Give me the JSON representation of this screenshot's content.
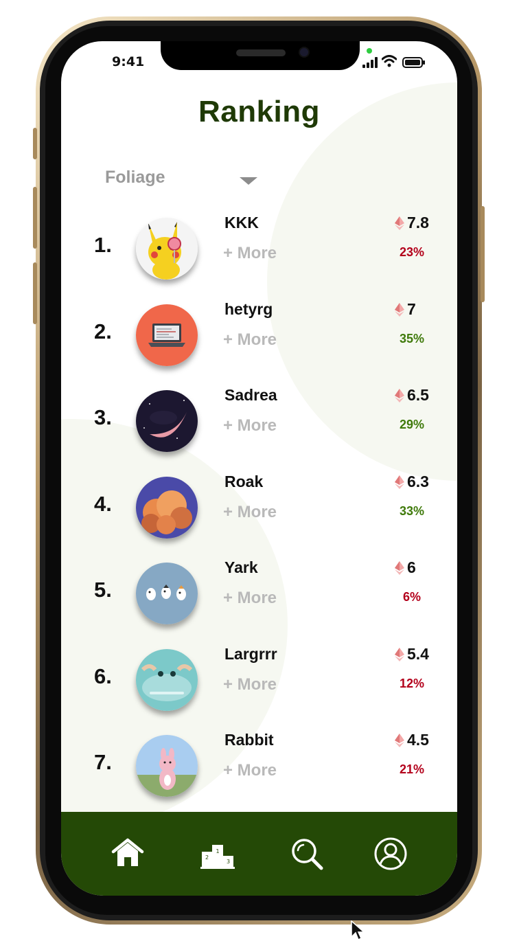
{
  "status": {
    "time": "9:41"
  },
  "header": {
    "title": "Ranking"
  },
  "filter": {
    "selected": "Foliage"
  },
  "colors": {
    "brand_green": "#244906",
    "title_green": "#1f3a06",
    "positive": "#3f7a0b",
    "negative": "#b3001b"
  },
  "rankings": [
    {
      "rank": "1.",
      "name": "KKK",
      "more": "+ More",
      "score": "7.8",
      "change": "23%",
      "trend": "negative",
      "avatar": "pikachu-avatar"
    },
    {
      "rank": "2.",
      "name": "hetyrg",
      "more": "+ More",
      "score": "7",
      "change": "35%",
      "trend": "positive",
      "avatar": "laptop-avatar"
    },
    {
      "rank": "3.",
      "name": "Sadrea",
      "more": "+ More",
      "score": "6.5",
      "change": "29%",
      "trend": "positive",
      "avatar": "moon-avatar"
    },
    {
      "rank": "4.",
      "name": "Roak",
      "more": "+ More",
      "score": "6.3",
      "change": "33%",
      "trend": "positive",
      "avatar": "cloud-avatar"
    },
    {
      "rank": "5.",
      "name": "Yark",
      "more": "+ More",
      "score": "6",
      "change": "6%",
      "trend": "negative",
      "avatar": "birds-avatar"
    },
    {
      "rank": "6.",
      "name": "Largrrr",
      "more": "+ More",
      "score": "5.4",
      "change": "12%",
      "trend": "negative",
      "avatar": "smile-avatar"
    },
    {
      "rank": "7.",
      "name": "Rabbit",
      "more": "+ More",
      "score": "4.5",
      "change": "21%",
      "trend": "negative",
      "avatar": "rabbit-avatar"
    }
  ],
  "nav": {
    "items": [
      "home-icon",
      "podium-icon",
      "search-icon",
      "profile-icon"
    ]
  }
}
